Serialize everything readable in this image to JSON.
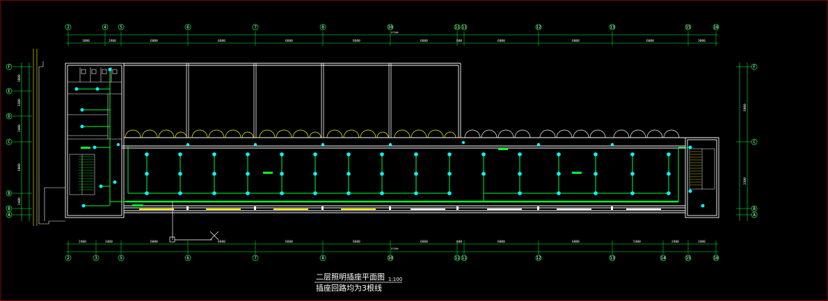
{
  "drawing": {
    "title": "二层照明插座平面图",
    "scale": "1:100",
    "note": "插座回路均为3根线"
  },
  "top_axes": [
    "2",
    "4",
    "5",
    "6",
    "7",
    "8",
    "10",
    "11",
    "12",
    "13",
    "15",
    "16"
  ],
  "bottom_axes": [
    "2",
    "3",
    "5",
    "6",
    "7",
    "8",
    "10",
    "11",
    "12",
    "13",
    "14",
    "15",
    "16"
  ],
  "left_axes": [
    "F",
    "E",
    "D",
    "C",
    "B",
    "A"
  ],
  "right_axes": [
    "F",
    "C",
    "B",
    "A"
  ],
  "top_dims": [
    "1800",
    "2400",
    "6000",
    "6600",
    "6600",
    "6600",
    "6600",
    "600",
    "6000",
    "6000",
    "6000",
    "3000"
  ],
  "bottom_dims": [
    "2400",
    "3400",
    "6000",
    "6600",
    "6600",
    "6600",
    "6600",
    "600",
    "6000",
    "6000",
    "5400",
    "2400",
    "3400"
  ],
  "left_dims": [
    "1800",
    "3300",
    "2400",
    "6000",
    "2400"
  ],
  "right_dims": [
    "6000",
    "3300"
  ],
  "total_dim_label": "57300",
  "colors": {
    "walls": "#ffffff",
    "axis": "#00ff33",
    "wiring": "#00ff33",
    "fixture": "#00ffff",
    "door": "#ffff00"
  }
}
